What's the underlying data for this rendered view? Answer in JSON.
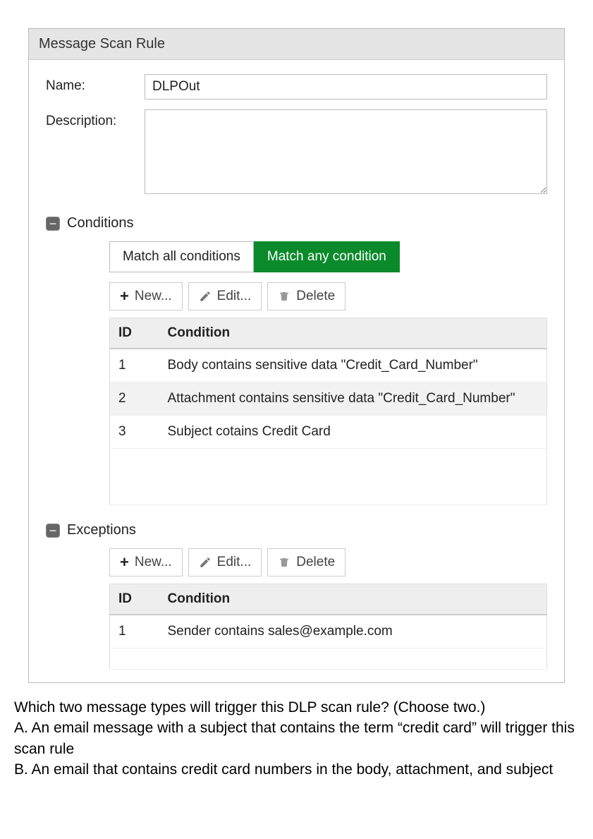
{
  "panel": {
    "title": "Message Scan Rule"
  },
  "form": {
    "name_label": "Name:",
    "name_value": "DLPOut",
    "description_label": "Description:",
    "description_value": ""
  },
  "conditions": {
    "title": "Conditions",
    "tab_all": "Match all conditions",
    "tab_any": "Match any condition",
    "active_tab": "any",
    "toolbar": {
      "new_label": "New...",
      "edit_label": "Edit...",
      "delete_label": "Delete"
    },
    "columns": {
      "id": "ID",
      "condition": "Condition"
    },
    "rows": [
      {
        "id": "1",
        "text": "Body contains sensitive data \"Credit_Card_Number\""
      },
      {
        "id": "2",
        "text": "Attachment contains sensitive data \"Credit_Card_Number\""
      },
      {
        "id": "3",
        "text": "Subject cotains Credit Card"
      }
    ]
  },
  "exceptions": {
    "title": "Exceptions",
    "toolbar": {
      "new_label": "New...",
      "edit_label": "Edit...",
      "delete_label": "Delete"
    },
    "columns": {
      "id": "ID",
      "condition": "Condition"
    },
    "rows": [
      {
        "id": "1",
        "text": "Sender contains sales@example.com"
      }
    ]
  },
  "question": {
    "prompt": "Which two message types will trigger this DLP scan rule? (Choose two.)",
    "choice_a": "A. An email message with a subject that contains the term “credit card” will trigger this scan rule",
    "choice_b": "B. An email that contains credit card numbers in the body, attachment, and subject"
  }
}
